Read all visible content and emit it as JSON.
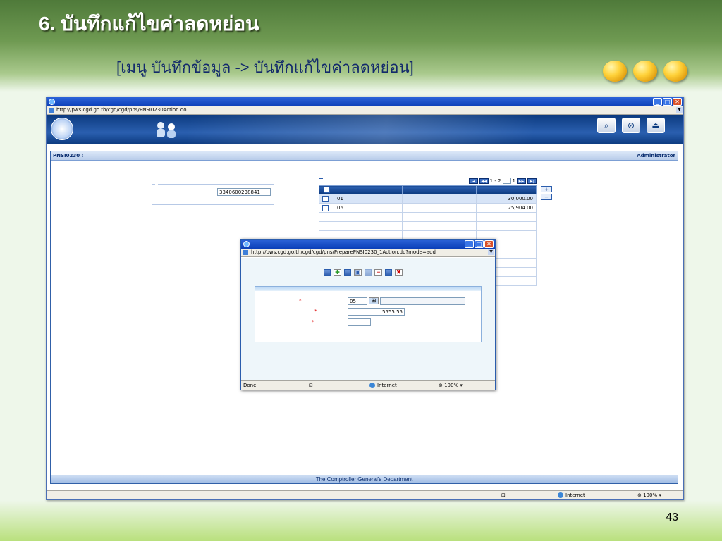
{
  "slide": {
    "title": "6. บันทึกแก้ไขค่าลดหย่อน",
    "subtitle": "[เมนู บันทึกข้อมูล -> บันทึกแก้ไขค่าลดหย่อน]",
    "page_number": "43"
  },
  "ie": {
    "title": "",
    "address": "http://pws.cgd.go.th/cgd/cgd/pns/PNSI0230Action.do",
    "status_zone": "Internet",
    "zoom": "100%"
  },
  "app": {
    "name": "",
    "tools": [
      {
        "label": "",
        "icon": "search-icon"
      },
      {
        "label": "",
        "icon": "cancel-icon"
      },
      {
        "label": "",
        "icon": "exit-icon"
      }
    ],
    "screen_code": "PNSI0230 :",
    "welcome": "Administrator",
    "footer": "The Comptroller General's Department"
  },
  "condition": {
    "legend": "",
    "id_label": "",
    "id_value": "3340600238841"
  },
  "grid": {
    "tab_label": "",
    "pager_text": "1 - 2",
    "page_of": "1",
    "columns": [
      "",
      "",
      "",
      ""
    ],
    "rows": [
      {
        "code": "01",
        "name": "",
        "amount": "30,000.00"
      },
      {
        "code": "06",
        "name": "",
        "amount": "25,904.00"
      }
    ]
  },
  "popup": {
    "title": "",
    "address": "http://pws.cgd.go.th/cgd/cgd/pns/PreparePNSI0230_1Action.do?mode=add",
    "buttons": [
      "",
      "",
      "",
      ""
    ],
    "form": {
      "code_label": "",
      "code_value": "05",
      "code_desc": "",
      "amount_label": "",
      "amount_value": "5555.55",
      "unit": "",
      "persons_label": "",
      "persons_value": ""
    },
    "status_done": "Done",
    "status_zone": "Internet",
    "zoom": "100%"
  }
}
